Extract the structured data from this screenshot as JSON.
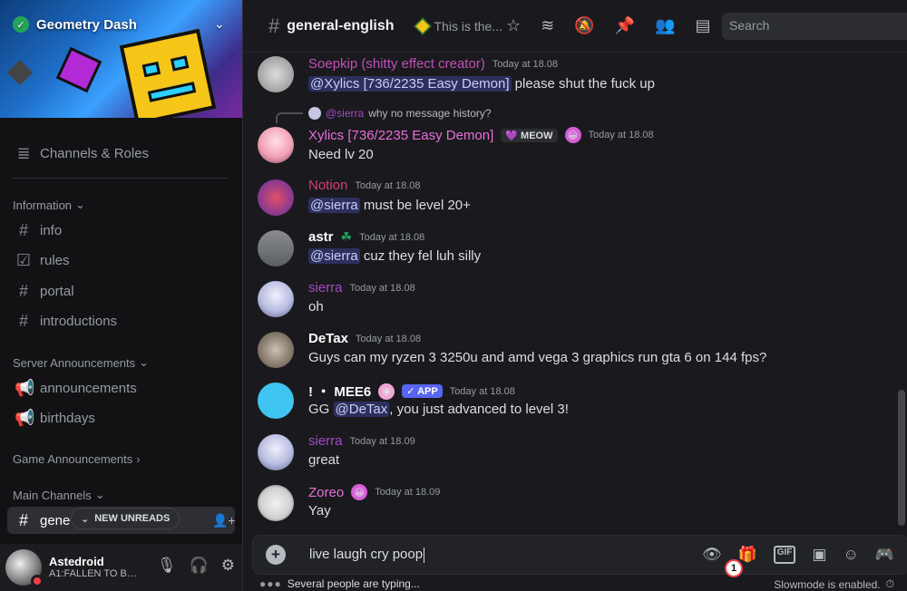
{
  "server": {
    "name": "Geometry Dash"
  },
  "sidebar": {
    "channels_roles": "Channels & Roles",
    "categories": {
      "information": "Information",
      "server_announcements": "Server Announcements",
      "game_announcements": "Game Announcements",
      "main_channels": "Main Channels"
    },
    "channels": {
      "info": "info",
      "rules": "rules",
      "portal": "portal",
      "introductions": "introductions",
      "announcements": "announcements",
      "birthdays": "birthdays",
      "active": "gene"
    },
    "new_unreads": "NEW UNREADS"
  },
  "user": {
    "name": "Astedroid",
    "status": "A1:FALLEN TO BE..."
  },
  "header": {
    "channel": "general-english",
    "topic": "This is the...",
    "search_placeholder": "Search"
  },
  "messages": [
    {
      "author": "Soepkip (shitty effect creator)",
      "author_color": "#c04fb8",
      "time": "Today at 18.08",
      "mention": "@Xylics [736/2235 Easy Demon]",
      "text": " please shut the fuck up"
    },
    {
      "reply_to": "@sierra",
      "reply_text": "why no message history?",
      "author": "Xylics [736/2235 Easy Demon]",
      "author_color": "#e86ed8",
      "tag": "MEOW",
      "time": "Today at 18.08",
      "text": "Need lv 20"
    },
    {
      "author": "Notion",
      "author_color": "#d83c7c",
      "time": "Today at 18.08",
      "mention": "@sierra",
      "text": " must be level 20+"
    },
    {
      "author": "astr",
      "author_color": "#ffffff",
      "time": "Today at 18.08",
      "mention": "@sierra",
      "text": " cuz they fel luh silly"
    },
    {
      "author": "sierra",
      "author_color": "#a24ac5",
      "time": "Today at 18.08",
      "text": "oh"
    },
    {
      "author": "DeTax",
      "author_color": "#ffffff",
      "time": "Today at 18.08",
      "text": "Guys can my ryzen 3 3250u and amd vega 3 graphics run gta 6 on 144 fps?"
    },
    {
      "author": "! ・ MEE6",
      "author_color": "#ffffff",
      "app_tag": "APP",
      "time": "Today at 18.08",
      "text_prefix": "GG ",
      "mention": "@DeTax",
      "text": ", you just advanced to level 3!"
    },
    {
      "author": "sierra",
      "author_color": "#a24ac5",
      "time": "Today at 18.09",
      "text": "great"
    },
    {
      "author": "Zoreo",
      "author_color": "#e86ed8",
      "time": "Today at 18.09",
      "text": "Yay"
    }
  ],
  "composer": {
    "text": "live laugh cry poop",
    "gift_count": "1"
  },
  "footer": {
    "typing": "Several people are typing...",
    "slowmode": "Slowmode is enabled."
  }
}
